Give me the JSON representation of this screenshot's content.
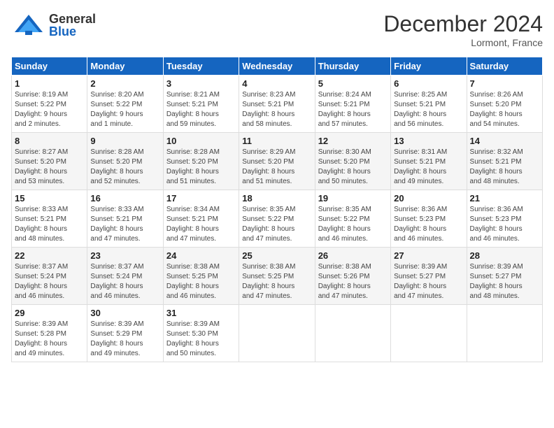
{
  "header": {
    "logo_general": "General",
    "logo_blue": "Blue",
    "title": "December 2024",
    "location": "Lormont, France"
  },
  "weekdays": [
    "Sunday",
    "Monday",
    "Tuesday",
    "Wednesday",
    "Thursday",
    "Friday",
    "Saturday"
  ],
  "weeks": [
    [
      {
        "day": "1",
        "info": "Sunrise: 8:19 AM\nSunset: 5:22 PM\nDaylight: 9 hours\nand 2 minutes."
      },
      {
        "day": "2",
        "info": "Sunrise: 8:20 AM\nSunset: 5:22 PM\nDaylight: 9 hours\nand 1 minute."
      },
      {
        "day": "3",
        "info": "Sunrise: 8:21 AM\nSunset: 5:21 PM\nDaylight: 8 hours\nand 59 minutes."
      },
      {
        "day": "4",
        "info": "Sunrise: 8:23 AM\nSunset: 5:21 PM\nDaylight: 8 hours\nand 58 minutes."
      },
      {
        "day": "5",
        "info": "Sunrise: 8:24 AM\nSunset: 5:21 PM\nDaylight: 8 hours\nand 57 minutes."
      },
      {
        "day": "6",
        "info": "Sunrise: 8:25 AM\nSunset: 5:21 PM\nDaylight: 8 hours\nand 56 minutes."
      },
      {
        "day": "7",
        "info": "Sunrise: 8:26 AM\nSunset: 5:20 PM\nDaylight: 8 hours\nand 54 minutes."
      }
    ],
    [
      {
        "day": "8",
        "info": "Sunrise: 8:27 AM\nSunset: 5:20 PM\nDaylight: 8 hours\nand 53 minutes."
      },
      {
        "day": "9",
        "info": "Sunrise: 8:28 AM\nSunset: 5:20 PM\nDaylight: 8 hours\nand 52 minutes."
      },
      {
        "day": "10",
        "info": "Sunrise: 8:28 AM\nSunset: 5:20 PM\nDaylight: 8 hours\nand 51 minutes."
      },
      {
        "day": "11",
        "info": "Sunrise: 8:29 AM\nSunset: 5:20 PM\nDaylight: 8 hours\nand 51 minutes."
      },
      {
        "day": "12",
        "info": "Sunrise: 8:30 AM\nSunset: 5:20 PM\nDaylight: 8 hours\nand 50 minutes."
      },
      {
        "day": "13",
        "info": "Sunrise: 8:31 AM\nSunset: 5:21 PM\nDaylight: 8 hours\nand 49 minutes."
      },
      {
        "day": "14",
        "info": "Sunrise: 8:32 AM\nSunset: 5:21 PM\nDaylight: 8 hours\nand 48 minutes."
      }
    ],
    [
      {
        "day": "15",
        "info": "Sunrise: 8:33 AM\nSunset: 5:21 PM\nDaylight: 8 hours\nand 48 minutes."
      },
      {
        "day": "16",
        "info": "Sunrise: 8:33 AM\nSunset: 5:21 PM\nDaylight: 8 hours\nand 47 minutes."
      },
      {
        "day": "17",
        "info": "Sunrise: 8:34 AM\nSunset: 5:21 PM\nDaylight: 8 hours\nand 47 minutes."
      },
      {
        "day": "18",
        "info": "Sunrise: 8:35 AM\nSunset: 5:22 PM\nDaylight: 8 hours\nand 47 minutes."
      },
      {
        "day": "19",
        "info": "Sunrise: 8:35 AM\nSunset: 5:22 PM\nDaylight: 8 hours\nand 46 minutes."
      },
      {
        "day": "20",
        "info": "Sunrise: 8:36 AM\nSunset: 5:23 PM\nDaylight: 8 hours\nand 46 minutes."
      },
      {
        "day": "21",
        "info": "Sunrise: 8:36 AM\nSunset: 5:23 PM\nDaylight: 8 hours\nand 46 minutes."
      }
    ],
    [
      {
        "day": "22",
        "info": "Sunrise: 8:37 AM\nSunset: 5:24 PM\nDaylight: 8 hours\nand 46 minutes."
      },
      {
        "day": "23",
        "info": "Sunrise: 8:37 AM\nSunset: 5:24 PM\nDaylight: 8 hours\nand 46 minutes."
      },
      {
        "day": "24",
        "info": "Sunrise: 8:38 AM\nSunset: 5:25 PM\nDaylight: 8 hours\nand 46 minutes."
      },
      {
        "day": "25",
        "info": "Sunrise: 8:38 AM\nSunset: 5:25 PM\nDaylight: 8 hours\nand 47 minutes."
      },
      {
        "day": "26",
        "info": "Sunrise: 8:38 AM\nSunset: 5:26 PM\nDaylight: 8 hours\nand 47 minutes."
      },
      {
        "day": "27",
        "info": "Sunrise: 8:39 AM\nSunset: 5:27 PM\nDaylight: 8 hours\nand 47 minutes."
      },
      {
        "day": "28",
        "info": "Sunrise: 8:39 AM\nSunset: 5:27 PM\nDaylight: 8 hours\nand 48 minutes."
      }
    ],
    [
      {
        "day": "29",
        "info": "Sunrise: 8:39 AM\nSunset: 5:28 PM\nDaylight: 8 hours\nand 49 minutes."
      },
      {
        "day": "30",
        "info": "Sunrise: 8:39 AM\nSunset: 5:29 PM\nDaylight: 8 hours\nand 49 minutes."
      },
      {
        "day": "31",
        "info": "Sunrise: 8:39 AM\nSunset: 5:30 PM\nDaylight: 8 hours\nand 50 minutes."
      },
      {
        "day": "",
        "info": ""
      },
      {
        "day": "",
        "info": ""
      },
      {
        "day": "",
        "info": ""
      },
      {
        "day": "",
        "info": ""
      }
    ]
  ]
}
